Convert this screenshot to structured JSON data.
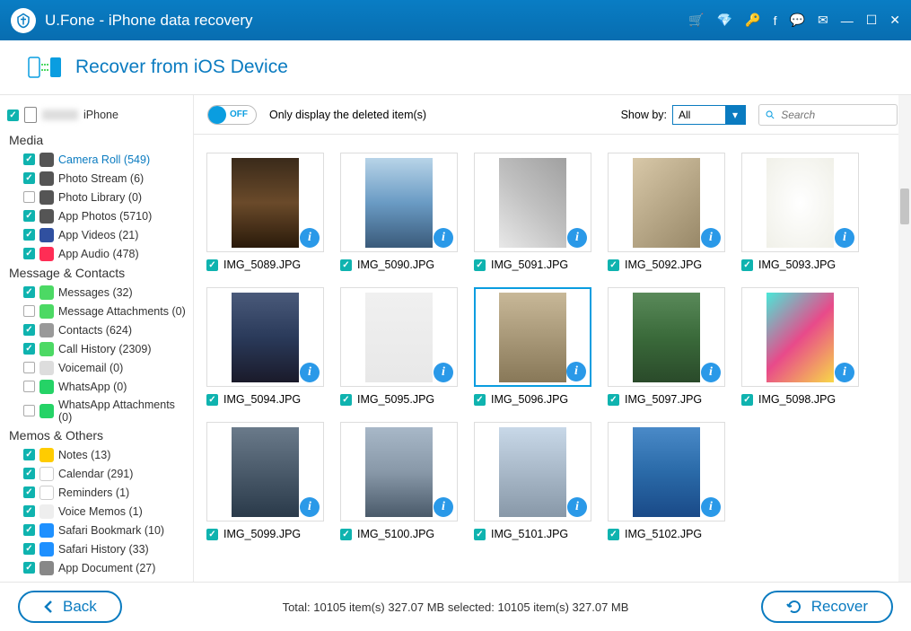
{
  "title": "U.Fone - iPhone data recovery",
  "sub_title": "Recover from iOS Device",
  "device_name": "iPhone",
  "groups": [
    {
      "label": "Media",
      "items": [
        {
          "label": "Camera Roll (549)",
          "checked": true,
          "active": true,
          "iconBg": "#555"
        },
        {
          "label": "Photo Stream (6)",
          "checked": true,
          "iconBg": "#555"
        },
        {
          "label": "Photo Library (0)",
          "checked": false,
          "iconBg": "#555"
        },
        {
          "label": "App Photos (5710)",
          "checked": true,
          "iconBg": "#555"
        },
        {
          "label": "App Videos (21)",
          "checked": true,
          "iconBg": "#3050a0"
        },
        {
          "label": "App Audio (478)",
          "checked": true,
          "iconBg": "#ff2d55"
        }
      ]
    },
    {
      "label": "Message & Contacts",
      "items": [
        {
          "label": "Messages (32)",
          "checked": true,
          "iconBg": "#4cd964"
        },
        {
          "label": "Message Attachments (0)",
          "checked": false,
          "iconBg": "#4cd964"
        },
        {
          "label": "Contacts (624)",
          "checked": true,
          "iconBg": "#999"
        },
        {
          "label": "Call History (2309)",
          "checked": true,
          "iconBg": "#4cd964"
        },
        {
          "label": "Voicemail (0)",
          "checked": false,
          "iconBg": "#ddd"
        },
        {
          "label": "WhatsApp (0)",
          "checked": false,
          "iconBg": "#25d366"
        },
        {
          "label": "WhatsApp Attachments (0)",
          "checked": false,
          "iconBg": "#25d366"
        }
      ]
    },
    {
      "label": "Memos & Others",
      "items": [
        {
          "label": "Notes (13)",
          "checked": true,
          "iconBg": "#ffcc00"
        },
        {
          "label": "Calendar (291)",
          "checked": true,
          "iconBg": "#fff",
          "iconBorder": true
        },
        {
          "label": "Reminders (1)",
          "checked": true,
          "iconBg": "#fff",
          "iconBorder": true
        },
        {
          "label": "Voice Memos (1)",
          "checked": true,
          "iconBg": "#eee"
        },
        {
          "label": "Safari Bookmark (10)",
          "checked": true,
          "iconBg": "#1e90ff"
        },
        {
          "label": "Safari History (33)",
          "checked": true,
          "iconBg": "#1e90ff"
        },
        {
          "label": "App Document (27)",
          "checked": true,
          "iconBg": "#888"
        }
      ]
    }
  ],
  "toolbar": {
    "toggle_state": "OFF",
    "toggle_text": "Only display the deleted item(s)",
    "show_by_label": "Show by:",
    "show_by_value": "All",
    "search_placeholder": "Search"
  },
  "thumbnails": [
    {
      "name": "IMG_5089.JPG",
      "checked": true,
      "gradient": "linear-gradient(#3a2a1a,#6a4a2a,#2a1a0a)"
    },
    {
      "name": "IMG_5090.JPG",
      "checked": true,
      "gradient": "linear-gradient(#b8d4e8,#6a9bc4,#3a5a7a)"
    },
    {
      "name": "IMG_5091.JPG",
      "checked": true,
      "gradient": "linear-gradient(45deg,#e8e8e8,#c0c0c0,#a0a0a0)"
    },
    {
      "name": "IMG_5092.JPG",
      "checked": true,
      "gradient": "linear-gradient(135deg,#d8c8a8,#b8a888,#988868)"
    },
    {
      "name": "IMG_5093.JPG",
      "checked": true,
      "gradient": "radial-gradient(#ffffff,#f0f0e8)"
    },
    {
      "name": "IMG_5094.JPG",
      "checked": true,
      "gradient": "linear-gradient(#4a5a7a,#2a3a5a,#1a1a2a)"
    },
    {
      "name": "IMG_5095.JPG",
      "checked": true,
      "gradient": "linear-gradient(#f0f0f0,#e8e8e8)"
    },
    {
      "name": "IMG_5096.JPG",
      "checked": true,
      "selected": true,
      "gradient": "linear-gradient(#c8b898,#a89878,#887858)"
    },
    {
      "name": "IMG_5097.JPG",
      "checked": true,
      "gradient": "linear-gradient(#5a8a5a,#3a6a3a,#2a4a2a)"
    },
    {
      "name": "IMG_5098.JPG",
      "checked": true,
      "gradient": "linear-gradient(135deg,#4ae8d8,#e84a8a,#f8d848)"
    },
    {
      "name": "IMG_5099.JPG",
      "checked": true,
      "gradient": "linear-gradient(#6a7a8a,#4a5a6a,#2a3a4a)"
    },
    {
      "name": "IMG_5100.JPG",
      "checked": true,
      "gradient": "linear-gradient(#a8b8c8,#8898a8,#4a5a6a)"
    },
    {
      "name": "IMG_5101.JPG",
      "checked": true,
      "gradient": "linear-gradient(#c8d8e8,#a8b8c8,#8898a8)"
    },
    {
      "name": "IMG_5102.JPG",
      "checked": true,
      "gradient": "linear-gradient(#4a8ac8,#2a6aa8,#1a4a88)"
    }
  ],
  "footer": {
    "back": "Back",
    "status": "Total: 10105 item(s) 327.07 MB    selected: 10105 item(s) 327.07 MB",
    "recover": "Recover"
  }
}
